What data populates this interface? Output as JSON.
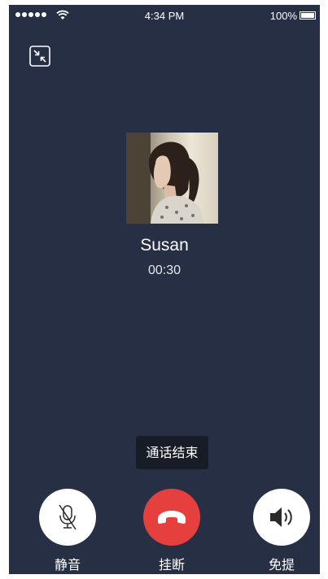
{
  "status_bar": {
    "time": "4:34 PM",
    "battery_percent": "100%",
    "signal_bars": 5,
    "wifi_icon": "wifi-icon",
    "battery_level": 1.0
  },
  "minimize_icon": "minimize-icon",
  "caller": {
    "name": "Susan",
    "duration": "00:30",
    "avatar_icon": "avatar-photo"
  },
  "toast": {
    "message": "通话结束"
  },
  "controls": {
    "mute": {
      "label": "静音",
      "icon": "microphone-muted-icon"
    },
    "hangup": {
      "label": "挂断",
      "icon": "phone-hangup-icon",
      "color": "#e5403d"
    },
    "speaker": {
      "label": "免提",
      "icon": "speaker-icon"
    }
  },
  "colors": {
    "background": "#262f44",
    "hangup": "#e5403d",
    "toast": "#171c27"
  }
}
